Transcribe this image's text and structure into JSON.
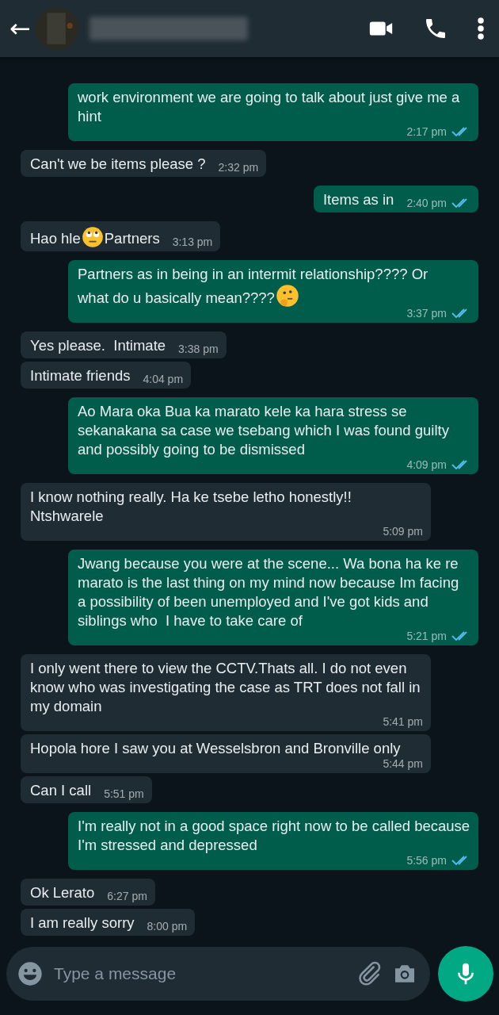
{
  "header": {
    "back": "←"
  },
  "messages": [
    {
      "outgoing": true,
      "text": "work environment we are going to talk about just give me a hint",
      "time": "2:17 pm",
      "read": true
    },
    {
      "outgoing": false,
      "text": "Can't we be items please ?",
      "time": "2:32 pm"
    },
    {
      "outgoing": true,
      "text": "Items as in",
      "time": "2:40 pm",
      "read": true
    },
    {
      "outgoing": false,
      "segments": [
        {
          "kind": "text",
          "text": "Hao hle"
        },
        {
          "kind": "eyeroll"
        },
        {
          "kind": "text",
          "text": "Partners"
        }
      ],
      "time": "3:13 pm"
    },
    {
      "outgoing": true,
      "segments": [
        {
          "kind": "text",
          "text": "Partners as in being in an intermit relationship???? Or"
        },
        {
          "kind": "text",
          "text": "what do u basically mean????"
        },
        {
          "kind": "thinking"
        }
      ],
      "time": "3:37 pm",
      "read": true
    },
    {
      "outgoing": false,
      "text": "Yes please.  Intimate",
      "time": "3:38 pm"
    },
    {
      "outgoing": false,
      "text": "Intimate friends",
      "time": "4:04 pm"
    },
    {
      "outgoing": true,
      "text": "Ao Mara oka Bua ka marato kele ka hara stress se sekanakana sa case we tsebang which I was found guilty and possibly going to be dismissed",
      "time": "4:09 pm",
      "read": true
    },
    {
      "outgoing": false,
      "text": "I know nothing really. Ha ke tsebe letho honestly!! Ntshwarele",
      "time": "5:09 pm"
    },
    {
      "outgoing": true,
      "text": "Jwang because you were at the scene... Wa bona ha ke re marato is the last thing on my mind now because Im facing a possibility of been unemployed and I've got kids and siblings who  I have to take care of",
      "time": "5:21 pm",
      "read": true
    },
    {
      "outgoing": false,
      "text": "I only went there to view the CCTV.Thats all. I do not even know who was investigating the case as TRT does not fall in my domain",
      "time": "5:41 pm"
    },
    {
      "outgoing": false,
      "text": "Hopola hore I saw you at Wesselsbron and Bronville only",
      "time": "5:44 pm"
    },
    {
      "outgoing": false,
      "text": "Can I call",
      "time": "5:51 pm"
    },
    {
      "outgoing": true,
      "text": "I'm really not in a good space right now to be called because I'm stressed and depressed",
      "time": "5:56 pm",
      "read": true
    },
    {
      "outgoing": false,
      "text": "Ok Lerato",
      "time": "6:27 pm"
    },
    {
      "outgoing": false,
      "text": "I am really sorry",
      "time": "8:00 pm"
    }
  ],
  "composer": {
    "placeholder": "Type a message"
  }
}
